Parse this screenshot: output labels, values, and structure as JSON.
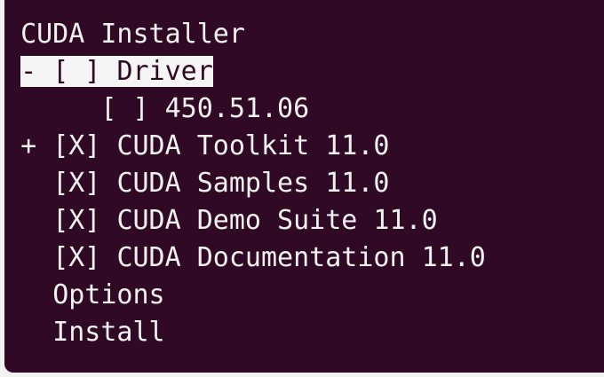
{
  "installer": {
    "title": "CUDA Installer",
    "items": [
      {
        "prefix": "- ",
        "checkbox": "[ ]",
        "label": "Driver",
        "selected": true
      },
      {
        "indent": "     ",
        "checkbox": "[ ]",
        "label": "450.51.06"
      },
      {
        "prefix": "+ ",
        "checkbox": "[X]",
        "label": "CUDA Toolkit 11.0"
      },
      {
        "prefix": "  ",
        "checkbox": "[X]",
        "label": "CUDA Samples 11.0"
      },
      {
        "prefix": "  ",
        "checkbox": "[X]",
        "label": "CUDA Demo Suite 11.0"
      },
      {
        "prefix": "  ",
        "checkbox": "[X]",
        "label": "CUDA Documentation 11.0"
      }
    ],
    "options_label": "Options",
    "install_label": "Install"
  },
  "colors": {
    "terminal_background": "#300a24",
    "foreground": "#f0f0f0",
    "selection_background": "#f5f5f5"
  }
}
